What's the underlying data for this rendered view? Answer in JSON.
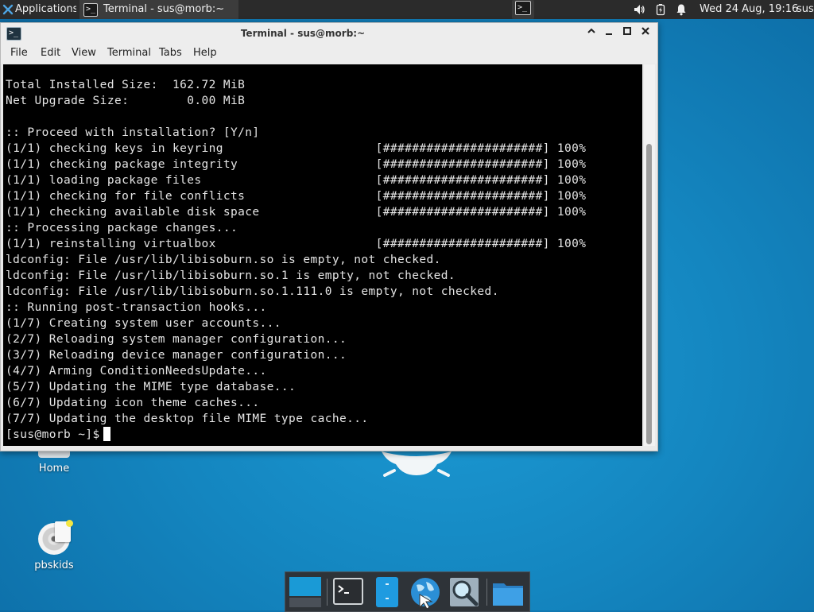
{
  "panel": {
    "apps_label": "Applications",
    "task_title": "Terminal - sus@morb:~",
    "clock": "Wed 24 Aug, 19:16",
    "user": "sus"
  },
  "desktop": {
    "home_label": "Home",
    "pbskids_label": "pbskids"
  },
  "window": {
    "title": "Terminal - sus@morb:~",
    "menus": [
      "File",
      "Edit",
      "View",
      "Terminal",
      "Tabs",
      "Help"
    ],
    "lines": [
      "Total Installed Size:  162.72 MiB",
      "Net Upgrade Size:        0.00 MiB",
      "",
      ":: Proceed with installation? [Y/n]",
      "(1/1) checking keys in keyring                     [######################] 100%",
      "(1/1) checking package integrity                   [######################] 100%",
      "(1/1) loading package files                        [######################] 100%",
      "(1/1) checking for file conflicts                  [######################] 100%",
      "(1/1) checking available disk space                [######################] 100%",
      ":: Processing package changes...",
      "(1/1) reinstalling virtualbox                      [######################] 100%",
      "ldconfig: File /usr/lib/libisoburn.so is empty, not checked.",
      "ldconfig: File /usr/lib/libisoburn.so.1 is empty, not checked.",
      "ldconfig: File /usr/lib/libisoburn.so.1.111.0 is empty, not checked.",
      ":: Running post-transaction hooks...",
      "(1/7) Creating system user accounts...",
      "(2/7) Reloading system manager configuration...",
      "(3/7) Reloading device manager configuration...",
      "(4/7) Arming ConditionNeedsUpdate...",
      "(5/7) Updating the MIME type database...",
      "(6/7) Updating icon theme caches...",
      "(7/7) Updating the desktop file MIME type cache..."
    ],
    "prompt": "[sus@morb ~]$"
  },
  "icons": {
    "apps": "xfce-mouse-icon",
    "volume": "speaker-icon",
    "battery": "battery-charging-icon",
    "notifications": "bell-icon",
    "dock": [
      "show-desktop-icon",
      "terminal-icon",
      "file-manager-icon",
      "web-browser-icon",
      "app-finder-icon",
      "folder-icon"
    ]
  }
}
